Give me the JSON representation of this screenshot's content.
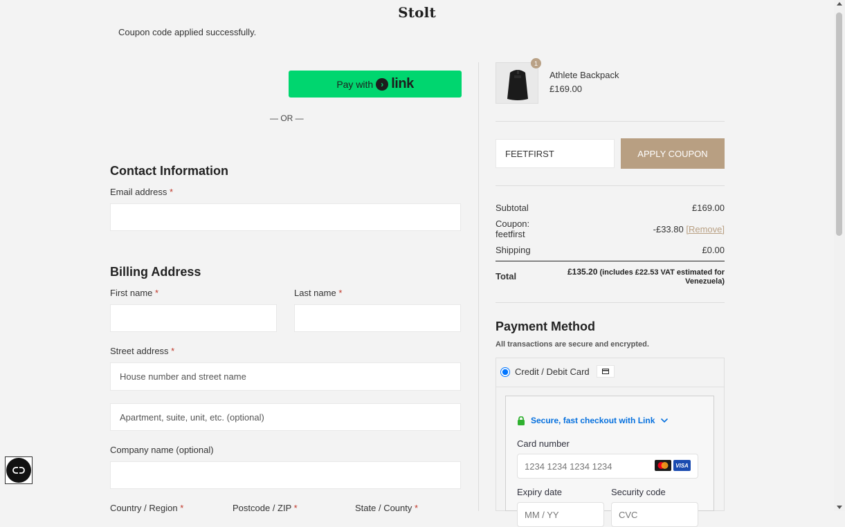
{
  "header": {
    "brand": "Stolt"
  },
  "notice": "Coupon code applied successfully.",
  "express": {
    "pay_with": "Pay with",
    "link_word": "link",
    "or": "— OR —"
  },
  "contact": {
    "title": "Contact Information",
    "email_label": "Email address",
    "required_mark": "*"
  },
  "billing": {
    "title": "Billing Address",
    "first_name_label": "First name",
    "last_name_label": "Last name",
    "street_label": "Street address",
    "street_placeholder": "House number and street name",
    "apt_placeholder": "Apartment, suite, unit, etc. (optional)",
    "company_label": "Company name (optional)",
    "country_label": "Country / Region",
    "postcode_label": "Postcode / ZIP",
    "state_label": "State / County"
  },
  "order": {
    "product_name": "Athlete Backpack",
    "product_price": "£169.00",
    "quantity": "1",
    "coupon_value": "FEETFIRST",
    "apply_coupon": "APPLY COUPON",
    "subtotal_label": "Subtotal",
    "subtotal_value": "£169.00",
    "coupon_label_1": "Coupon:",
    "coupon_label_2": "feetfirst",
    "coupon_discount": "-£33.80",
    "remove_label": "[Remove]",
    "shipping_label": "Shipping",
    "shipping_value": "£0.00",
    "total_label": "Total",
    "total_value": "£135.20",
    "total_note_1": "(includes £22.53 VAT estimated for",
    "total_note_2": "Venezuela)"
  },
  "payment": {
    "title": "Payment Method",
    "subtitle": "All transactions are secure and encrypted.",
    "option_label": "Credit / Debit Card",
    "link_checkout": "Secure, fast checkout with Link",
    "card_number_label": "Card number",
    "card_number_placeholder": "1234 1234 1234 1234",
    "expiry_label": "Expiry date",
    "expiry_placeholder": "MM / YY",
    "security_label": "Security code",
    "security_placeholder": "CVC",
    "visa": "VISA"
  },
  "colors": {
    "accent": "#b89f82",
    "link_green": "#00d66f",
    "stripe_blue": "#0570de"
  }
}
